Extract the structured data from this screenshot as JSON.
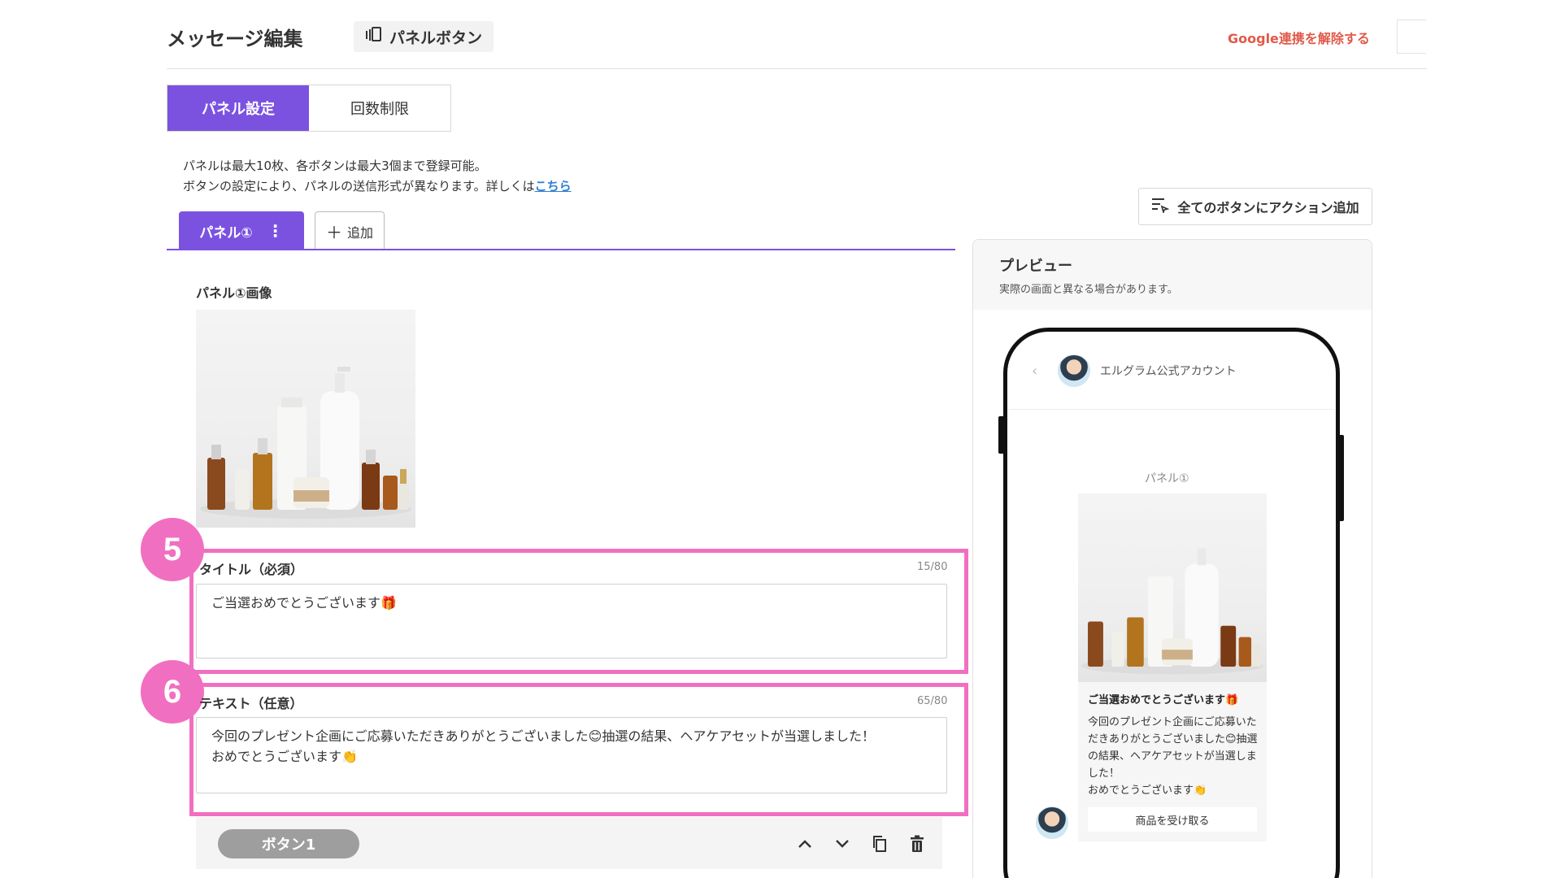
{
  "header": {
    "title": "メッセージ編集",
    "chip_label": "パネルボタン",
    "google_link": "Google連携を解除する"
  },
  "settings_tabs": [
    {
      "label": "パネル設定",
      "active": true
    },
    {
      "label": "回数制限",
      "active": false
    }
  ],
  "info": {
    "line1": "パネルは最大10枚、各ボタンは最大3個まで登録可能。",
    "line2": "ボタンの設定により、パネルの送信形式が異なります。詳しくは",
    "link": "こちら"
  },
  "panel_tabs": {
    "active_label": "パネル①",
    "add_label": "追加"
  },
  "panel_image": {
    "label": "パネル①画像"
  },
  "title_field": {
    "label": "タイトル（必須）",
    "counter": "15/80",
    "value": "ご当選おめでとうございます🎁"
  },
  "text_field": {
    "label": "テキスト（任意）",
    "counter": "65/80",
    "value": "今回のプレゼント企画にご応募いただきありがとうございました😊抽選の結果、ヘアケアセットが当選しました！\nおめでとうございます👏"
  },
  "steps": {
    "title_step": "5",
    "text_step": "6"
  },
  "button_row": {
    "label": "ボタン1"
  },
  "right": {
    "all_actions_label": "全てのボタンにアクション追加",
    "preview_title": "プレビュー",
    "preview_subtitle": "実際の画面と異なる場合があります。"
  },
  "phone": {
    "account_name": "エルグラム公式アカウント",
    "panel_label": "パネル①",
    "card_title": "ご当選おめでとうございます🎁",
    "card_text": "今回のプレゼント企画にご応募いただきありがとうございました😊抽選の結果、ヘアケアセットが当選しました！\nおめでとうございます👏",
    "card_button": "商品を受け取る"
  },
  "colors": {
    "accent": "#7b52e0",
    "highlight": "#f16fc0",
    "link_red": "#e05a4a",
    "link_blue": "#2d7fd3"
  },
  "icons": [
    "panel-icon",
    "kebab-icon",
    "plus-icon",
    "chevron-up-icon",
    "chevron-down-icon",
    "copy-icon",
    "trash-icon",
    "action-list-icon",
    "back-icon",
    "avatar"
  ]
}
